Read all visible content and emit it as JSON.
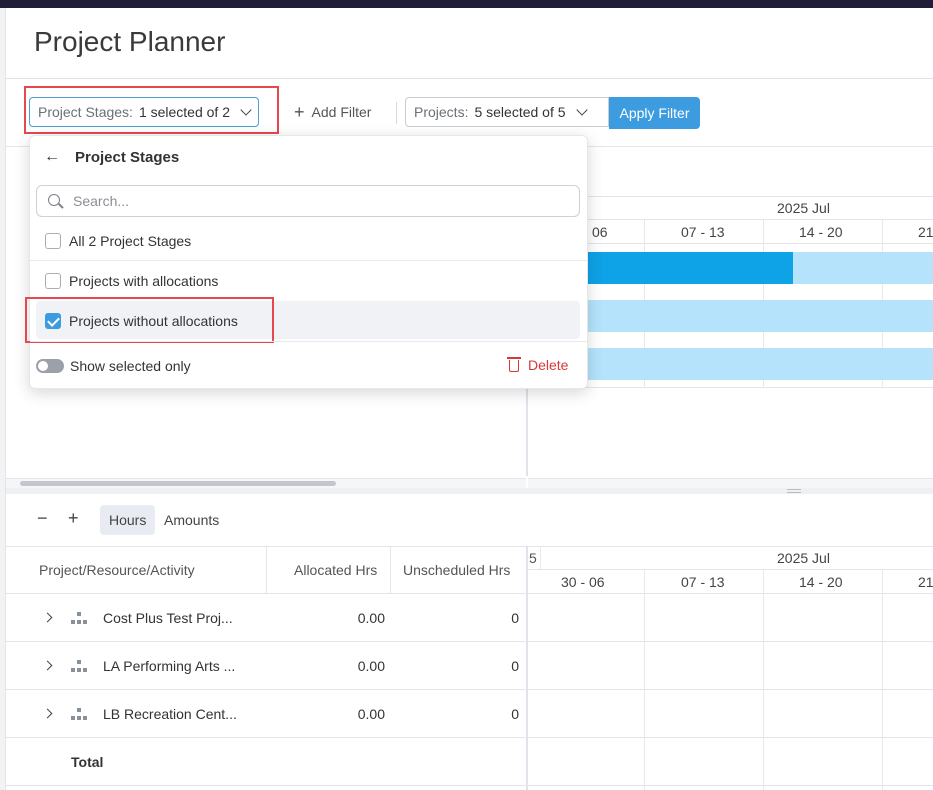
{
  "page": {
    "title": "Project Planner"
  },
  "filters": {
    "stages": {
      "label": "Project Stages:",
      "value": "1 selected of 2"
    },
    "add_filter": "Add Filter",
    "projects": {
      "label": "Projects:",
      "value": "5 selected of 5"
    },
    "apply": "Apply Filter"
  },
  "dropdown": {
    "title": "Project Stages",
    "search_placeholder": "Search...",
    "options": [
      {
        "label": "All 2 Project Stages",
        "checked": false
      },
      {
        "label": "Projects with allocations",
        "checked": false
      },
      {
        "label": "Projects without allocations",
        "checked": true
      }
    ],
    "show_selected_only": "Show selected only",
    "delete": "Delete"
  },
  "upper_gantt": {
    "month": "2025 Jul",
    "weeks": [
      "06",
      "07 - 13",
      "14 - 20",
      "21"
    ]
  },
  "lower": {
    "toggles": {
      "hours": "Hours",
      "amounts": "Amounts"
    },
    "columns": {
      "name": "Project/Resource/Activity",
      "allocated": "Allocated Hrs",
      "unscheduled": "Unscheduled Hrs"
    },
    "gantt_month_prefix": "5",
    "gantt_month": "2025 Jul",
    "weeks": [
      "30 - 06",
      "07 - 13",
      "14 - 20",
      "21"
    ],
    "rows": [
      {
        "name": "Cost Plus Test Proj...",
        "allocated": "0.00",
        "unscheduled": "0"
      },
      {
        "name": "LA Performing Arts ...",
        "allocated": "0.00",
        "unscheduled": "0"
      },
      {
        "name": "LB Recreation Cent...",
        "allocated": "0.00",
        "unscheduled": "0"
      }
    ],
    "total_label": "Total"
  },
  "colors": {
    "accent": "#3d9be0",
    "bar_dark": "#0ea2e6",
    "bar_light": "#b5e3fb",
    "danger": "#d93838",
    "highlight": "#e5484d"
  }
}
